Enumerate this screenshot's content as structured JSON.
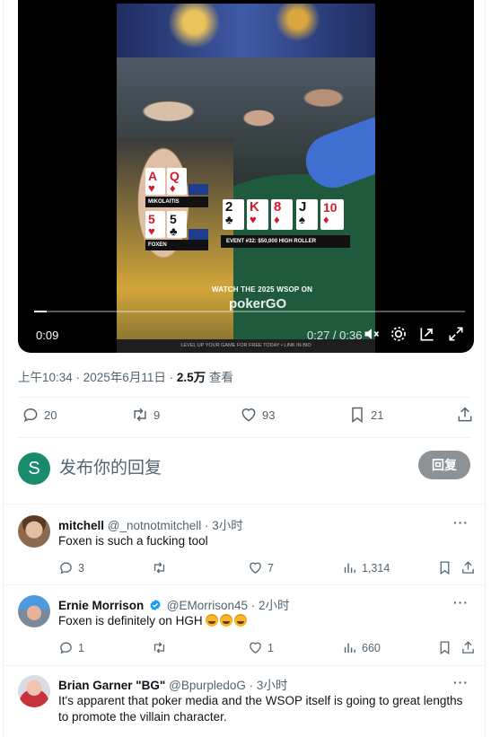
{
  "video": {
    "current_time": "0:09",
    "duration": "0:27 / 0:36",
    "progress": 0.03,
    "player1": {
      "cards": [
        {
          "rank": "A",
          "suit": "♥",
          "color": "red"
        },
        {
          "rank": "Q",
          "suit": "♦",
          "color": "red"
        }
      ],
      "name": "MIKOLAITIS"
    },
    "player2": {
      "cards": [
        {
          "rank": "5",
          "suit": "♥",
          "color": "red"
        },
        {
          "rank": "5",
          "suit": "♣",
          "color": "black"
        }
      ],
      "name": "FOXEN"
    },
    "board": [
      {
        "rank": "2",
        "suit": "♣",
        "color": "black"
      },
      {
        "rank": "K",
        "suit": "♥",
        "color": "red"
      },
      {
        "rank": "8",
        "suit": "♦",
        "color": "red"
      },
      {
        "rank": "J",
        "suit": "♠",
        "color": "black"
      },
      {
        "rank": "10",
        "suit": "♦",
        "color": "red"
      }
    ],
    "event_label": "EVENT #32: $50,000 HIGH ROLLER",
    "promo_text": "WATCH THE 2025 WSOP ON",
    "promo_brand": "pokerGO",
    "strip_text": "LEVEL UP YOUR GAME FOR FREE TODAY • LINK IN BIO"
  },
  "meta": {
    "time": "上午10:34 · 2025年6月11日 · ",
    "views": "2.5万",
    "views_label": " 查看"
  },
  "actions": {
    "replies": "20",
    "reposts": "9",
    "likes": "93",
    "bookmarks": "21"
  },
  "compose": {
    "avatar_letter": "S",
    "placeholder": "发布你的回复",
    "button": "回复"
  },
  "replies": [
    {
      "name": "mitchell",
      "handle": "@_notnotmitchell",
      "time": " · 3小时",
      "text": "Foxen is such a fucking tool",
      "verified": false,
      "replies": "3",
      "reposts": "",
      "likes": "7",
      "views": "1,314"
    },
    {
      "name": "Ernie Morrison",
      "handle": "@EMorrison45",
      "time": " · 2小时",
      "text": "Foxen is definitely on HGH",
      "verified": true,
      "replies": "1",
      "reposts": "",
      "likes": "1",
      "views": "660"
    },
    {
      "name": "Brian Garner \"BG\"",
      "handle": "@BpurpledoG",
      "time": " · 3小时",
      "text": "It's apparent that poker media and the WSOP itself is going to great lengths to promote the villain character.",
      "verified": false
    }
  ],
  "colors": {
    "accent": "#1d9bf0",
    "muted": "#536471",
    "reply_button": "#8d9296",
    "avatar_s": "#1a8a6c"
  }
}
